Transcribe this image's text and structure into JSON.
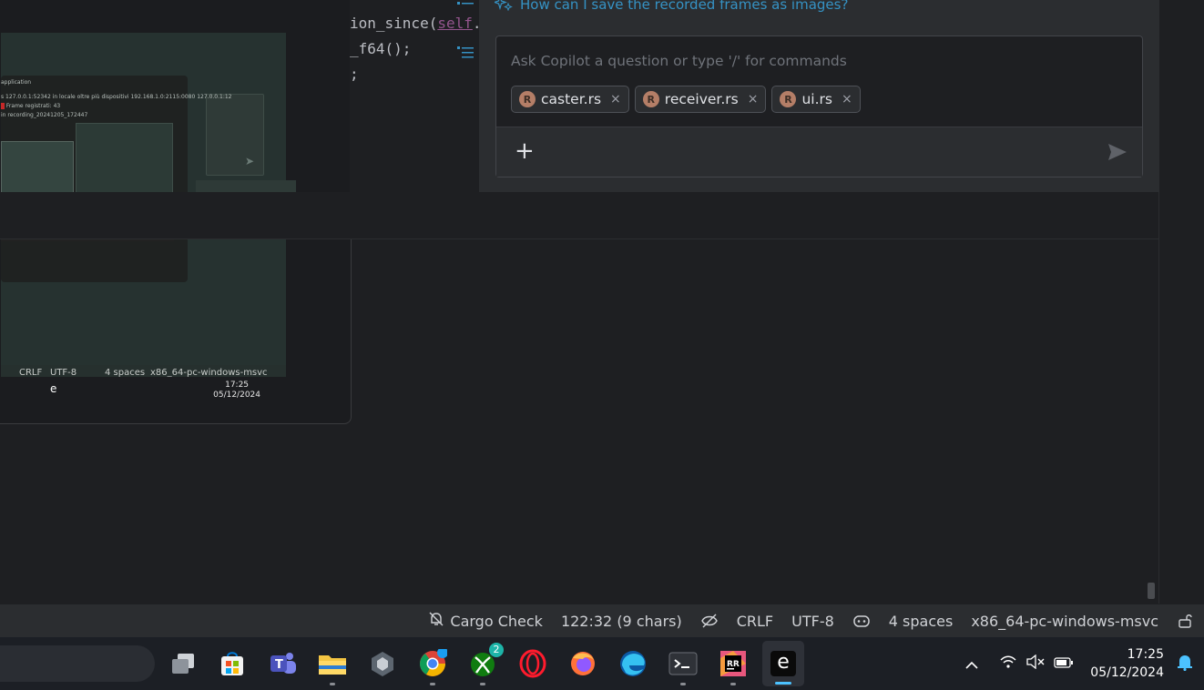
{
  "editor": {
    "line1": "ion_since(",
    "line1_self": "self",
    "line1_tail": ".",
    "line2": "_f64();",
    "line3": ";"
  },
  "copilot": {
    "suggestion": "How can I save the recorded frames as images?",
    "placeholder": "Ask Copilot a question or type '/' for commands",
    "chips": [
      {
        "label": "caster.rs"
      },
      {
        "label": "receiver.rs"
      },
      {
        "label": "ui.rs"
      }
    ],
    "close_glyph": "×",
    "add_glyph": "+"
  },
  "thumbnail": {
    "app_title": "application",
    "log1": "s 127.0.0.1:52342 in locale oltre più dispositivi 192.168.1.0:2115:0080   127.0.0.1:12",
    "log2_badge": "",
    "log2": "Frame registrati: 43",
    "log3": "in recording_20241205_172447",
    "status": {
      "line_ending": "CRLF",
      "encoding": "UTF-8",
      "indent": "4 spaces",
      "target": "x86_64-pc-windows-msvc"
    },
    "clock_time": "17:25",
    "clock_date": "05/12/2024"
  },
  "statusbar": {
    "cargo_check": "Cargo Check",
    "position": "122:32 (9 chars)",
    "line_ending": "CRLF",
    "encoding": "UTF-8",
    "indent": "4 spaces",
    "target": "x86_64-pc-windows-msvc"
  },
  "taskbar": {
    "xbox_badge": "2",
    "clock_time": "17:25",
    "clock_date": "05/12/2024",
    "app_letter": "e"
  },
  "colors": {
    "accent_blue": "#3592c4",
    "background": "#1e1f22",
    "panel": "#2b2d30",
    "rust_icon": "#b47e67"
  }
}
